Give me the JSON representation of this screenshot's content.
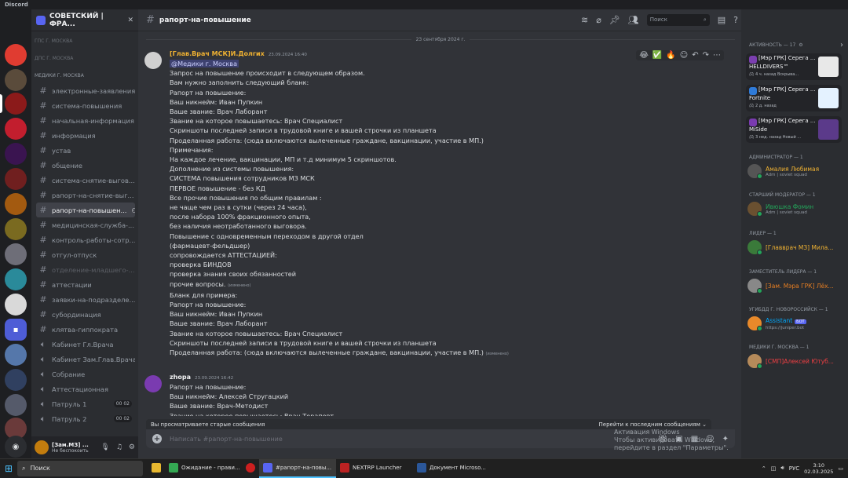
{
  "window": {
    "title": "Discord"
  },
  "server": {
    "name": "СОВЕТСКИЙ | ФРА...",
    "categories": [
      {
        "label": "ГПС Г. МОСКВА"
      },
      {
        "label": "ДПС Г. МОСКВА"
      },
      {
        "label": "МЕДИКИ Г. МОСКВА"
      }
    ],
    "channels": [
      {
        "label": "электронные-заявления",
        "type": "text"
      },
      {
        "label": "система-повышения",
        "type": "text"
      },
      {
        "label": "начальная-информация",
        "type": "text"
      },
      {
        "label": "информация",
        "type": "text"
      },
      {
        "label": "устав",
        "type": "text"
      },
      {
        "label": "общение",
        "type": "text"
      },
      {
        "label": "система-снятие-выгов...",
        "type": "text"
      },
      {
        "label": "рапорт-на-снятие-выг...",
        "type": "text"
      },
      {
        "label": "рапорт-на-повышен...",
        "type": "text",
        "selected": true
      },
      {
        "label": "медицинская-служба-...",
        "type": "text"
      },
      {
        "label": "контроль-работы-сотр...",
        "type": "text"
      },
      {
        "label": "отгул-отпуск",
        "type": "text"
      },
      {
        "label": "отделение-младшего-...",
        "type": "text",
        "muted": true
      },
      {
        "label": "аттестации",
        "type": "text"
      },
      {
        "label": "заявки-на-подразделе...",
        "type": "text"
      },
      {
        "label": "субординация",
        "type": "text"
      },
      {
        "label": "клятва-гиппократа",
        "type": "text"
      },
      {
        "label": "Кабинет Гл.Врача",
        "type": "voice"
      },
      {
        "label": "Кабинет Зам.Глав.Врача",
        "type": "voice"
      },
      {
        "label": "Собрание",
        "type": "voice"
      },
      {
        "label": "Аттестационная",
        "type": "voice"
      },
      {
        "label": "Патруль 1",
        "type": "voice",
        "c1": "00",
        "c2": "02"
      },
      {
        "label": "Патруль 2",
        "type": "voice",
        "c1": "00",
        "c2": "02"
      }
    ]
  },
  "user": {
    "name": "[Зам.МЗ] ...",
    "status": "Не беспокоить"
  },
  "channel": {
    "name": "рапорт-на-повышение",
    "search_placeholder": "Поиск"
  },
  "date_separator": "23 сентября 2024 г.",
  "messages": [
    {
      "author": "[Глав.Врач МСК]И.Долгих",
      "timestamp": "23.09.2024 16:40",
      "author_color": "#f0b232",
      "lines": [
        "@Медики г. Москва",
        "Запрос на повышение происходит в следующем образом.",
        "Вам нужно заполнить следующий бланк:",
        "Рапорт на повышение:",
        "Ваш никнейм: Иван Пупкин",
        "Ваше звание: Врач Лаборант",
        "Звание на которое повышаетесь: Врач Специалист",
        "Скриншоты последней записи в трудовой книге и вашей строчки из планшета",
        "Проделанная работа: (сюда включаются вылеченные граждане, вакцинации, участие в МП.)",
        "Примечания:",
        "На каждое лечение, вакцинации, МП и т.д минимум 5 скриншотов.",
        "Дополнение из системы повышения:",
        "СИСТЕМА повышения сотрудников МЗ МСК",
        "ПЕРВОЕ повышение - без КД",
        "Все прочие повышения по общим правилам :",
        "не чаще чем раз в сутки (через 24 часа),",
        "после набора 100% фракционного опыта,",
        "без наличия неотработанного выговора.",
        "Повышение с одновременным переходом в другой отдел",
        "(фармацевт-фельдшер)",
        "сопровождается АТТЕСТАЦИЕЙ:",
        "проверка БИНДОВ",
        "проверка знания своих обязанностей",
        "прочие вопросы.",
        "Бланк для примера:",
        "Рапорт на повышение:",
        "Ваш никнейм: Иван Пупкин",
        "Ваше звание: Врач Лаборант",
        "Звание на которое повышаетесь: Врач Специалист",
        "Скриншоты последней записи в трудовой книге и вашей строчки из планшета",
        "Проделанная работа: (сюда включаются вылеченные граждане, вакцинации, участие в МП.)"
      ],
      "edited": "(изменено)"
    },
    {
      "author": "zhopa",
      "timestamp": "23.09.2024 16:42",
      "author_color": "#f2f3f5",
      "lines": [
        "Рапорт на повышение:",
        "Ваш никнейм: Алексей Стругацкий",
        "Ваше звание: Врач-Методист",
        "Звание на которое повышаетесь: Врач-Терапевт"
      ]
    }
  ],
  "old_messages_bar": {
    "text": "Вы просматриваете старые сообщения",
    "jump": "Перейти к последним сообщениям"
  },
  "composer": {
    "placeholder": "Написать #рапорт-на-повышение"
  },
  "watermark": {
    "line1": "Активация Windows",
    "line2": "Чтобы активировать Windows, перейдите в раздел \"Параметры\"."
  },
  "members": {
    "activity_header": "АКТИВНОСТЬ — 17",
    "activities": [
      {
        "user": "[Мэр ГРК] Серега ...",
        "game": "HELLDIVERS™",
        "time": "4 ч. назад",
        "extra": "Вскрыва..."
      },
      {
        "user": "[Мэр ГРК] Серега ...",
        "game": "Fortnite",
        "time": "2 д. назад",
        "extra": ""
      },
      {
        "user": "[Мэр ГРК] Серега ...",
        "game": "MiSide",
        "time": "3 нед. назад",
        "extra": "Новый ..."
      }
    ],
    "groups": [
      {
        "label": "АДМИНИСТРАТОР — 1",
        "name": "Амалия Любимая",
        "sub": "Adm | soviet squad",
        "color": "#f0b232"
      },
      {
        "label": "СТАРШИЙ МОДЕРАТОР — 1",
        "name": "Ивюшка Фомин",
        "sub": "Adm | soviet squad",
        "color": "#23a55a"
      },
      {
        "label": "ЛИДЕР — 1",
        "name": "[Главврач МЗ] Мила...",
        "sub": "",
        "color": "#f0b232"
      },
      {
        "label": "ЗАМЕСТИТЕЛЬ ЛИДЕРА — 1",
        "name": "[Зам. Мэра ГРК] Лёх...",
        "sub": "",
        "color": "#e67e22"
      },
      {
        "label": "УГИБДД Г. НОВОРОССИЙСК — 1",
        "name": "Assistant",
        "sub": "https://juniper.bot",
        "color": "#00a8fc",
        "badge": "БОТ"
      },
      {
        "label": "МЕДИКИ Г. МОСКВА — 1",
        "name": "[СМП]Алексей Ютуб...",
        "sub": "",
        "color": "#f23f43"
      }
    ]
  },
  "taskbar": {
    "search": "Поиск",
    "apps": [
      {
        "label": "Ожидание - прави..."
      },
      {
        "label": ""
      },
      {
        "label": "#рапорт-на-повы...",
        "active": true
      },
      {
        "label": "NEXTRP Launcher"
      },
      {
        "label": "Документ Microso..."
      }
    ],
    "lang": "РУС",
    "time": "3:10",
    "date": "02.03.2025"
  }
}
